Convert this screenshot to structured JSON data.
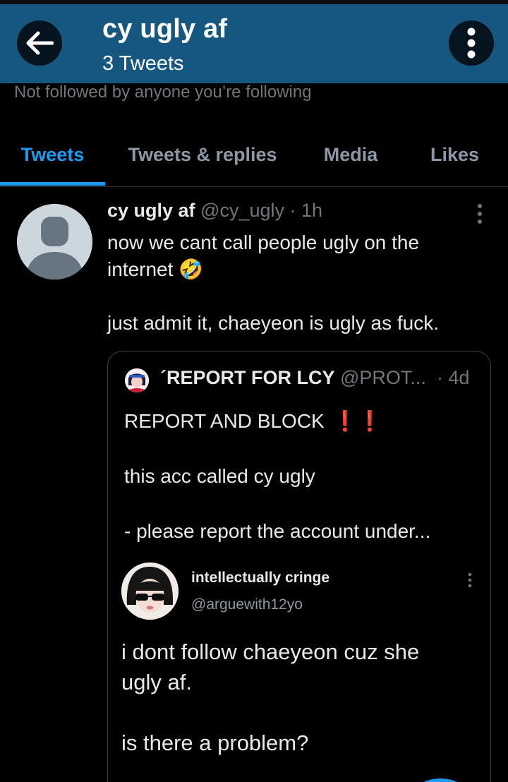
{
  "header": {
    "title": "cy ugly af",
    "subtitle": "3 Tweets",
    "bg_color": "#15577f",
    "back_icon": "arrow-left-icon",
    "more_icon": "vertical-dots-icon"
  },
  "profile": {
    "followed_note": "Not followed by anyone you’re following"
  },
  "tabs": [
    {
      "label": "Tweets",
      "active": true
    },
    {
      "label": "Tweets & replies",
      "active": false
    },
    {
      "label": "Media",
      "active": false
    },
    {
      "label": "Likes",
      "active": false
    }
  ],
  "tweet": {
    "name": "cy ugly af",
    "handle": "@cy_ugly",
    "time": "· 1h",
    "text": "now we cant call people ugly on the\ninternet 🤣\n\njust admit it, chaeyeon is ugly as fuck.",
    "quote": {
      "name": "´REPORT FOR LCY",
      "handle": "@PROT...",
      "time": "· 4d",
      "line1": "REPORT AND BLOCK",
      "line1_marks": "❗❗",
      "body": "this acc called cy ugly\n\n- please report the account under...",
      "screenshot": {
        "name": "intellectually cringe",
        "handle": "@arguewith12yo",
        "text": "i dont follow chaeyeon cuz she\nugly af.\n\nis there a problem?"
      }
    }
  },
  "colors": {
    "accent": "#1d9bf0",
    "muted": "#71767b",
    "alert": "#e0245e"
  }
}
